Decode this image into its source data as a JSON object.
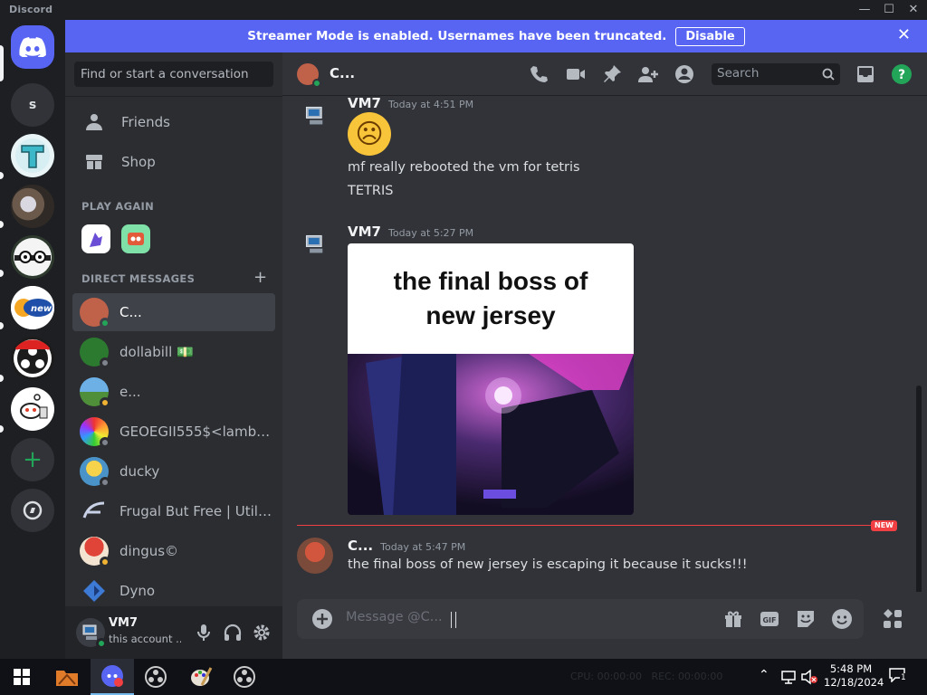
{
  "window": {
    "title": "Discord",
    "minimize": "—",
    "maximize": "☐",
    "close": "✕"
  },
  "banner": {
    "text": "Streamer Mode is enabled. Usernames have been truncated.",
    "button": "Disable",
    "close": "✕"
  },
  "servers": [
    {
      "name": "discord-home"
    },
    {
      "name": "S",
      "label": "s"
    },
    {
      "name": "T"
    },
    {
      "name": "server-3"
    },
    {
      "name": "server-4"
    },
    {
      "name": "server-5",
      "label": "newo"
    },
    {
      "name": "server-6"
    },
    {
      "name": "server-7"
    }
  ],
  "sidebar": {
    "search_placeholder": "Find or start a conversation",
    "friends": "Friends",
    "shop": "Shop",
    "play_again": "PLAY AGAIN",
    "direct_messages": "DIRECT MESSAGES",
    "add": "+",
    "dms": [
      {
        "name": "C...",
        "color": "#c0614a",
        "status": "online"
      },
      {
        "name": "dollabill 💵",
        "color": "#2c7a2f",
        "status": "offline"
      },
      {
        "name": "e...",
        "color": "#4f8f3a",
        "status": "idle"
      },
      {
        "name": "GEOEGII555$<lambd...",
        "color": "#8a3fd1",
        "status": "offline"
      },
      {
        "name": "ducky",
        "color": "#4a93c9",
        "status": "offline"
      },
      {
        "name": "Frugal But Free | Utilit...",
        "color": "#3d4a66",
        "status": "none"
      },
      {
        "name": "dingus©",
        "color": "#b6433a",
        "status": "idle"
      },
      {
        "name": "Dyno",
        "color": "#3c7ad6",
        "status": "none"
      }
    ]
  },
  "user": {
    "name": "VM7",
    "status": "this account ..."
  },
  "chat": {
    "recipient": "C...",
    "search": "Search",
    "messages": [
      {
        "author": "VM7",
        "time": "Today at 4:51 PM",
        "emoji": "☹",
        "lines": [
          "mf really rebooted the vm for tetris",
          "TETRIS"
        ]
      },
      {
        "author": "VM7",
        "time": "Today at 5:27 PM",
        "image_caption": "the final boss of new jersey"
      },
      {
        "author": "C...",
        "time": "Today at 5:47 PM",
        "text": "the final boss of new jersey is escaping it because it sucks!!!"
      }
    ],
    "new_badge": "NEW",
    "composer_placeholder": "Message @C..."
  },
  "taskbar": {
    "time": "5:48 PM",
    "date": "12/18/2024",
    "ghost": "CPU: 00:00:00   REC: 00:00:00",
    "notifications": "1"
  },
  "colors": {
    "accent": "#5865f2",
    "online": "#23a559",
    "idle": "#f0b232",
    "offline": "#80848e",
    "new": "#f23f43"
  }
}
